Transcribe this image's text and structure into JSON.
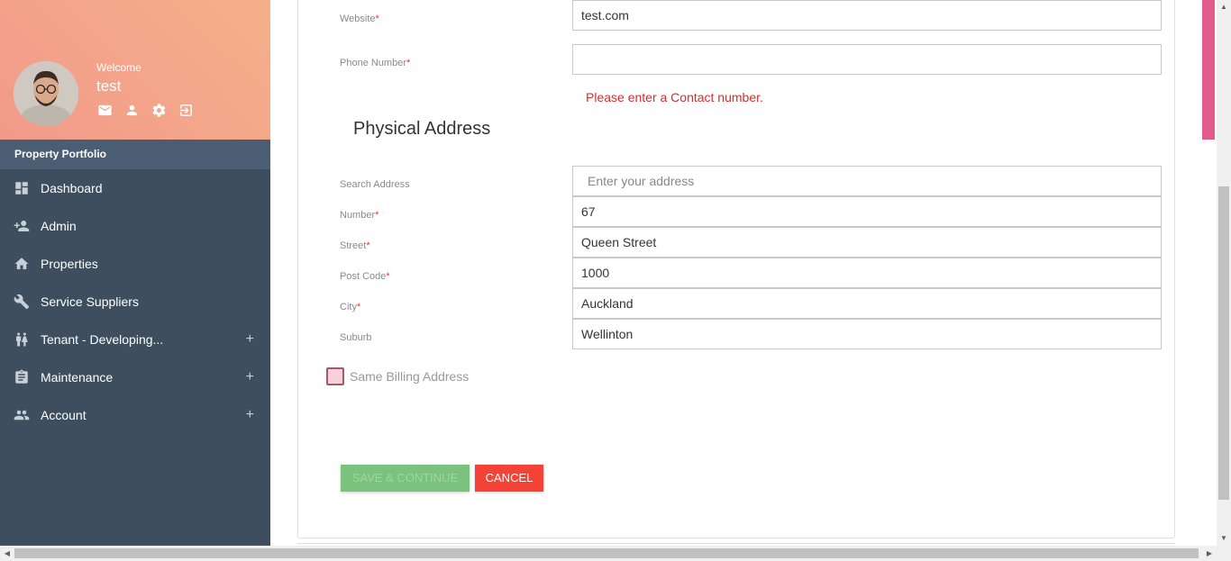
{
  "sidebar": {
    "welcome": "Welcome",
    "username": "test",
    "section_title": "Property Portfolio",
    "profile_icons": [
      "mail-icon",
      "person-icon",
      "settings-icon",
      "logout-icon"
    ],
    "items": [
      {
        "label": "Dashboard",
        "icon": "dashboard-icon",
        "expandable": false
      },
      {
        "label": "Admin",
        "icon": "person-add-icon",
        "expandable": false
      },
      {
        "label": "Properties",
        "icon": "home-icon",
        "expandable": false
      },
      {
        "label": "Service Suppliers",
        "icon": "wrench-icon",
        "expandable": false
      },
      {
        "label": "Tenant - Developing...",
        "icon": "people-icon",
        "expandable": true,
        "plus": "+"
      },
      {
        "label": "Maintenance",
        "icon": "clipboard-icon",
        "expandable": true,
        "plus": "+"
      },
      {
        "label": "Account",
        "icon": "group-icon",
        "expandable": true,
        "plus": "+"
      }
    ],
    "colors": {
      "sidebar_bg": "#3e4e5e",
      "section_bg": "#4a5d73",
      "profile_gradient_start": "#f29a8a",
      "profile_gradient_end": "#f5b08a"
    }
  },
  "form": {
    "website_label": "Website",
    "website_value": "test.com",
    "phone_label": "Phone Number",
    "phone_value": "",
    "phone_error": "Please enter a Contact number.",
    "required_mark": "*",
    "physical_address_heading": "Physical Address",
    "search_label": "Search Address",
    "search_placeholder": "Enter your address",
    "number_label": "Number",
    "number_value": "67",
    "street_label": "Street",
    "street_value": "Queen Street",
    "postcode_label": "Post Code",
    "postcode_value": "1000",
    "city_label": "City",
    "city_value": "Auckland",
    "suburb_label": "Suburb",
    "suburb_value": "Wellinton",
    "same_billing_label": "Same Billing Address",
    "same_billing_checked": false
  },
  "buttons": {
    "save_label": "SAVE & CONTINUE",
    "cancel_label": "CANCEL",
    "colors": {
      "save": "#7ac27e",
      "cancel": "#f44336"
    }
  },
  "scrollbars": {
    "up_arrow": "▲",
    "down_arrow": "▼",
    "left_arrow": "◀",
    "right_arrow": "▶"
  }
}
